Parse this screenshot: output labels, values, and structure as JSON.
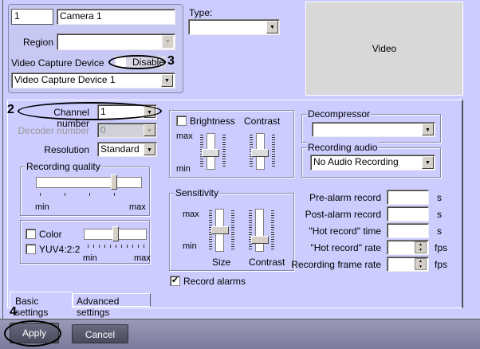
{
  "camera": {
    "id": "1",
    "name": "Camera 1",
    "region_label": "Region",
    "region_value": "",
    "vcd_label": "Video Capture Device",
    "disable_label": "Disable",
    "disable_checked": false,
    "vcd_value": "Video Capture Device 1"
  },
  "type": {
    "label": "Type:",
    "value": ""
  },
  "video": {
    "label": "Video"
  },
  "basic": {
    "channel_label": "Channel number",
    "channel_value": "1",
    "decoder_label": "Decoder number",
    "decoder_value": "0",
    "resolution_label": "Resolution",
    "resolution_value": "Standard",
    "quality": {
      "label": "Recording quality",
      "min": "min",
      "max": "max",
      "value_pct": 75
    },
    "color": {
      "color_label": "Color",
      "color_checked": false,
      "yuv_label": "YUV4:2:2",
      "yuv_checked": false,
      "min": "min",
      "max": "max",
      "value_pct": 50
    },
    "brightness": {
      "label": "Brightness",
      "checked": false,
      "contrast_label": "Contrast",
      "max": "max",
      "min": "min",
      "brightness_pct": 50,
      "contrast_pct": 50
    },
    "sensitivity": {
      "label": "Sensitivity",
      "max": "max",
      "min": "min",
      "size_label": "Size",
      "contrast_label": "Contrast",
      "size_pct": 55,
      "contrast_pct": 25
    },
    "record_alarms": {
      "label": "Record alarms",
      "checked": true
    },
    "decompressor": {
      "label": "Decompressor",
      "value": ""
    },
    "audio": {
      "label": "Recording audio",
      "value": "No Audio Recording"
    },
    "fields": [
      {
        "label": "Pre-alarm record",
        "value": "",
        "unit": "s"
      },
      {
        "label": "Post-alarm record",
        "value": "",
        "unit": "s"
      },
      {
        "label": "\"Hot record\" time",
        "value": "",
        "unit": "s"
      },
      {
        "label": "\"Hot record\" rate",
        "value": "",
        "unit": "fps"
      },
      {
        "label": "Recording frame rate",
        "value": "",
        "unit": "fps"
      }
    ]
  },
  "tabs": [
    {
      "label": "Basic settings",
      "active": true
    },
    {
      "label": "Advanced settings",
      "active": false
    }
  ],
  "footer": {
    "apply": "Apply",
    "cancel": "Cancel"
  },
  "annotations": {
    "n2": "2",
    "n3": "3",
    "n4": "4"
  }
}
